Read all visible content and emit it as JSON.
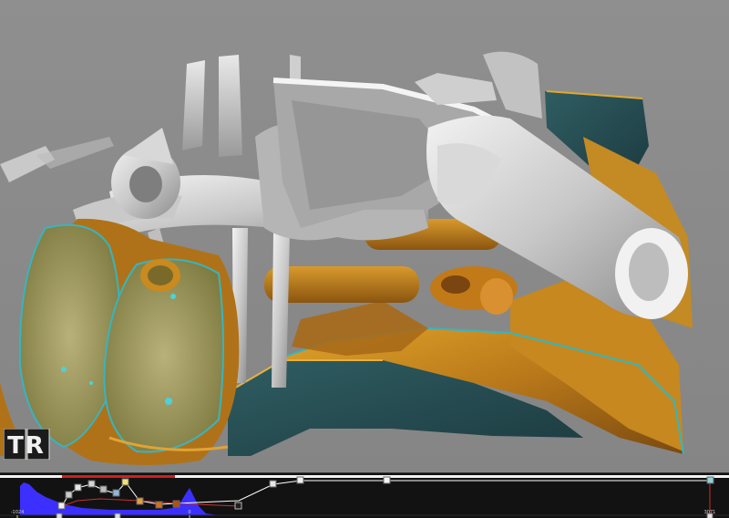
{
  "app": {
    "logo_text": "TR"
  },
  "transfer_function": {
    "axis_labels": [
      "-1024",
      "0",
      "3071"
    ],
    "histogram_color": "#3b30ff",
    "opacity_line_color": "#ffffff",
    "color_bar_accent": "#d21e1e",
    "control_point_count": 18
  },
  "colors": {
    "background": "#8a8a8a",
    "bone": "#d6d6d6",
    "tissue": "#c88a1f",
    "tissue_edge": "#2aa7b0",
    "panel": "#121212"
  }
}
